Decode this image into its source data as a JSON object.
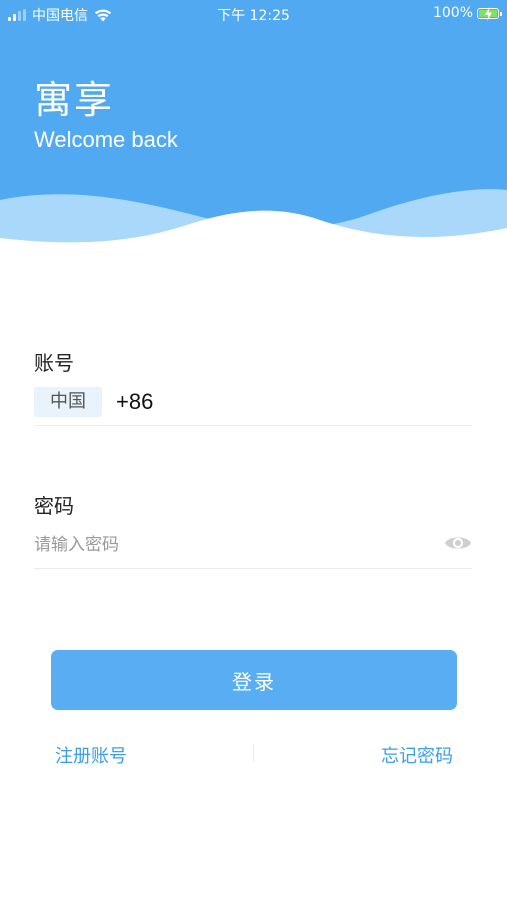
{
  "status_bar": {
    "carrier": "中国电信",
    "time": "下午 12:25",
    "battery": "100%",
    "signal_icon": "signal-icon",
    "wifi_icon": "wifi-icon",
    "battery_icon": "battery-charging-icon"
  },
  "header": {
    "title": "寓享",
    "subtitle": "Welcome back",
    "colors": {
      "primary": "#51a9f1",
      "wave_light": "#a9d8fb"
    }
  },
  "account": {
    "label": "账号",
    "country": "中国",
    "value": "+86"
  },
  "password": {
    "label": "密码",
    "placeholder": "请输入密码",
    "toggle_icon": "eye-icon"
  },
  "actions": {
    "login_label": "登录",
    "register_label": "注册账号",
    "forgot_label": "忘记密码",
    "button_color": "#58adf3",
    "link_color": "#3d9de8"
  }
}
